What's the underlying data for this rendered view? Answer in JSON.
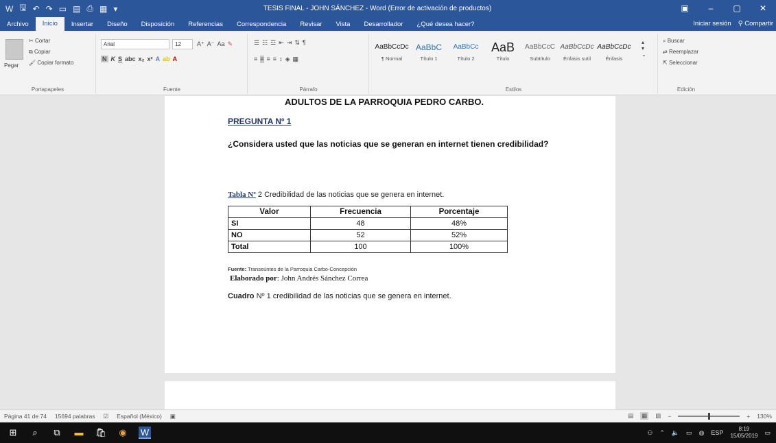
{
  "titlebar": {
    "title": "TESIS FINAL - JOHN SÁNCHEZ - Word (Error de activación de productos)",
    "qat_icons": [
      "save-icon",
      "undo-icon",
      "redo-icon",
      "new-doc-icon",
      "open-icon",
      "print-preview-icon",
      "table-icon",
      "customize-icon"
    ]
  },
  "tabs": [
    "Archivo",
    "Inicio",
    "Insertar",
    "Diseño",
    "Disposición",
    "Referencias",
    "Correspondencia",
    "Revisar",
    "Vista",
    "Desarrollador",
    "¿Qué desea hacer?"
  ],
  "active_tab": "Inicio",
  "tab_right": {
    "signin": "Iniciar sesión",
    "share": "Compartir"
  },
  "ribbon": {
    "clipboard": {
      "paste": "Pegar",
      "cut": "Cortar",
      "copy": "Copiar",
      "format_painter": "Copiar formato",
      "label": "Portapapeles"
    },
    "font": {
      "family": "Arial",
      "size": "12",
      "label": "Fuente"
    },
    "paragraph": {
      "label": "Párrafo"
    },
    "styles": {
      "label": "Estilos",
      "items": [
        {
          "sample": "AaBbCcDc",
          "name": "¶ Normal"
        },
        {
          "sample": "AaBbC",
          "name": "Título 1"
        },
        {
          "sample": "AaBbCc",
          "name": "Título 2"
        },
        {
          "sample": "AaB",
          "name": "Título"
        },
        {
          "sample": "AaBbCcC",
          "name": "Subtítulo"
        },
        {
          "sample": "AaBbCcDc",
          "name": "Énfasis sutil"
        },
        {
          "sample": "AaBbCcDc",
          "name": "Énfasis"
        }
      ]
    },
    "editing": {
      "find": "Buscar",
      "replace": "Reemplazar",
      "select": "Seleccionar",
      "label": "Edición"
    }
  },
  "document": {
    "heading_top": "ADULTOS DE LA PARROQUIA PEDRO CARBO.",
    "question_title": "PREGUNTA Nº 1",
    "question_text": "¿Considera usted que las noticias que se generan en internet tienen credibilidad?",
    "caption_lead": "Tabla Nº",
    "caption_rest": "2 Credibilidad de las noticias que se genera en internet.",
    "table": {
      "headers": [
        "Valor",
        "Frecuencia",
        "Porcentaje"
      ],
      "rows": [
        [
          "SI",
          "48",
          "48%"
        ],
        [
          "NO",
          "52",
          "52%"
        ],
        [
          "Total",
          "100",
          "100%"
        ]
      ]
    },
    "source_label": "Fuente:",
    "source_text": "Transeúntes de la Parroquia Carbo-Concepción",
    "elab_label": "Elaborado por",
    "elab_text": ": John Andrés Sánchez Correa",
    "cuadro_label": "Cuadro",
    "cuadro_text": "Nº 1 credibilidad de las noticias que se genera en internet."
  },
  "statusbar": {
    "page": "Página 41 de 74",
    "words": "15694 palabras",
    "language": "Español (México)",
    "zoom": "130%"
  },
  "taskbar": {
    "time": "8:19",
    "date": "15/05/2019",
    "lang": "ESP"
  }
}
